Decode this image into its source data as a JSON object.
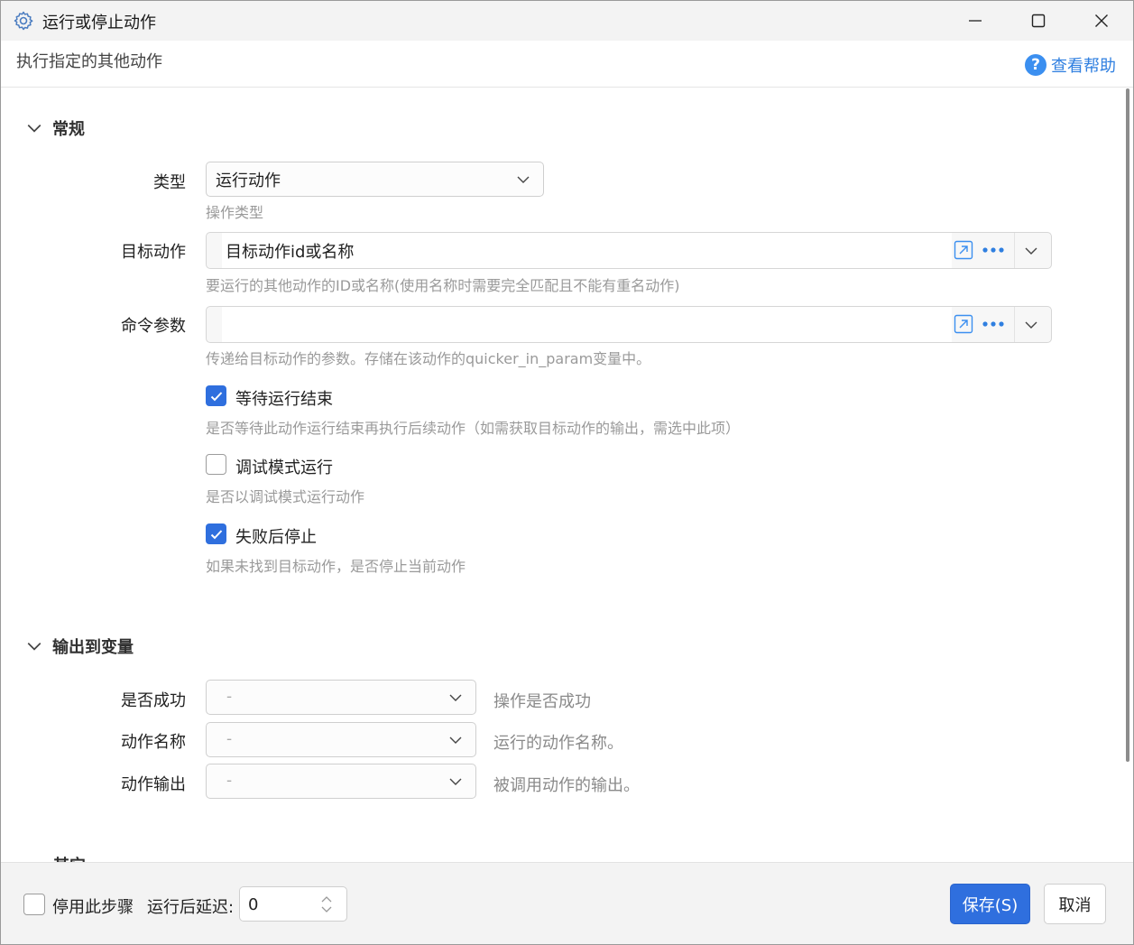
{
  "window": {
    "title": "运行或停止动作",
    "icon": "gear-icon"
  },
  "header": {
    "description": "执行指定的其他动作",
    "help_label": "查看帮助",
    "help_icon": "?"
  },
  "general": {
    "section_label": "常规",
    "type": {
      "label": "类型",
      "value": "运行动作",
      "hint": "操作类型"
    },
    "target": {
      "label": "目标动作",
      "placeholder": "目标动作id或名称",
      "hint": "要运行的其他动作的ID或名称(使用名称时需要完全匹配且不能有重名动作)"
    },
    "params": {
      "label": "命令参数",
      "value": "",
      "hint": "传递给目标动作的参数。存储在该动作的quicker_in_param变量中。"
    },
    "wait": {
      "label": "等待运行结束",
      "checked": true,
      "hint": "是否等待此动作运行结束再执行后续动作（如需获取目标动作的输出，需选中此项）"
    },
    "debug": {
      "label": "调试模式运行",
      "checked": false,
      "hint": "是否以调试模式运行动作"
    },
    "stop_on_fail": {
      "label": "失败后停止",
      "checked": true,
      "hint": "如果未找到目标动作，是否停止当前动作"
    }
  },
  "output": {
    "section_label": "输出到变量",
    "rows": [
      {
        "label": "是否成功",
        "value": "-",
        "desc": "操作是否成功"
      },
      {
        "label": "动作名称",
        "value": "-",
        "desc": "运行的动作名称。"
      },
      {
        "label": "动作输出",
        "value": "-",
        "desc": "被调用动作的输出。"
      }
    ]
  },
  "other": {
    "section_label": "其它"
  },
  "footer": {
    "disable_label": "停用此步骤",
    "delay_label": "运行后延迟:",
    "delay_value": "0",
    "save_label": "保存(S)",
    "cancel_label": "取消"
  },
  "colors": {
    "accent": "#2f6fde",
    "link": "#2f7fe0"
  }
}
